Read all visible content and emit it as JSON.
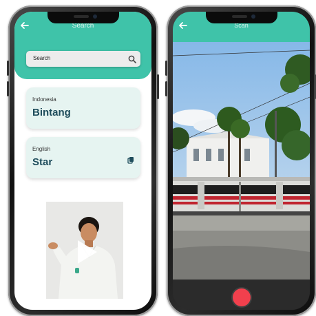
{
  "left_phone": {
    "header": {
      "back_icon": "arrow-left-icon",
      "title": "Search"
    },
    "search": {
      "placeholder": "Search",
      "icon": "search-icon"
    },
    "source_card": {
      "language": "Indonesia",
      "word": "Bintang"
    },
    "target_card": {
      "language": "English",
      "word": "Star",
      "icon": "copy-icon"
    },
    "video": {
      "icon": "play-icon"
    }
  },
  "right_phone": {
    "header": {
      "back_icon": "arrow-left-icon",
      "title": "Scan"
    },
    "camera": {
      "record_icon": "record-button-icon"
    }
  },
  "colors": {
    "accent": "#3fc3a9",
    "card_bg": "#e6f4f1",
    "word_text": "#1f4d5c",
    "record": "#f2404d"
  }
}
